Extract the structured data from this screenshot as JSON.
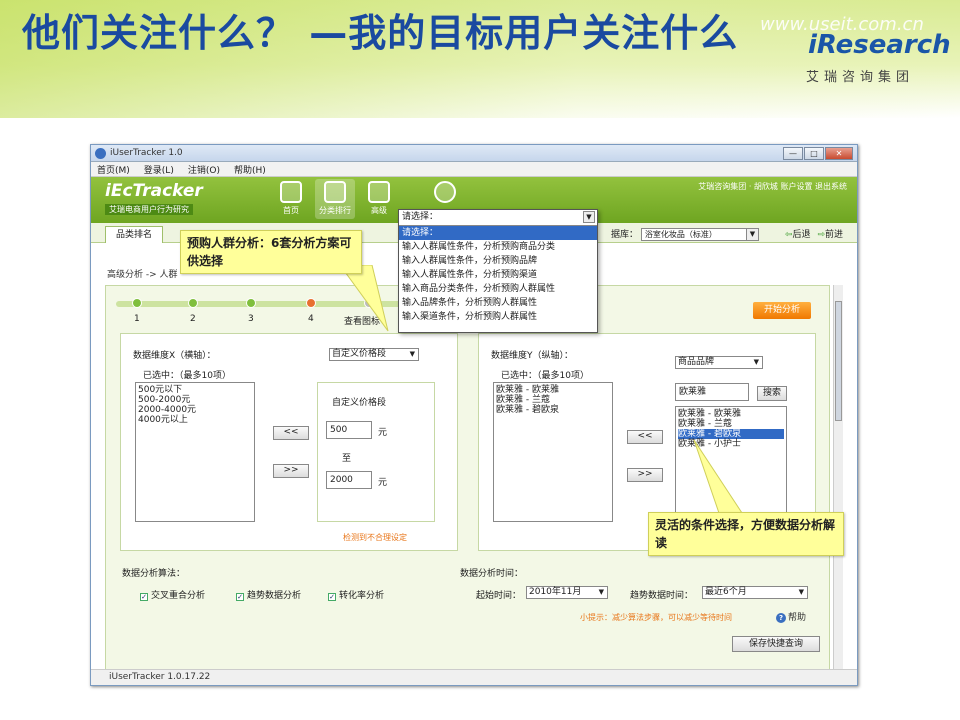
{
  "slide": {
    "title": "他们关注什么？  —我的目标用户关注什么",
    "watermark": "www.useit.com.cn",
    "logo": "iResearch",
    "logo_cn": "艾瑞咨询集团"
  },
  "window": {
    "title": "iUserTracker 1.0",
    "controls": [
      "—",
      "□",
      "✕"
    ],
    "menu": [
      "首页(M)",
      "登录(L)",
      "注销(O)",
      "帮助(H)"
    ],
    "brand": "iEcTracker",
    "brand_sub": "艾瑞电商用户行为研究",
    "nav": [
      "首页",
      "分类排行",
      "高级"
    ],
    "top_right": "艾瑞咨询集团 · 胡欣城  账户设置  退出系统",
    "tab": "品类排名",
    "db_label": "据库：",
    "db_value": "浴室化妆品（标准）",
    "back": "后退",
    "forward": "前进",
    "breadcrumb": "高级分析 -> 人群",
    "status": "iUserTracker 1.0.17.22"
  },
  "steps": {
    "labels": [
      "1",
      "2",
      "3",
      "4",
      "查看图标"
    ],
    "current_index": 3,
    "start_button": "开始分析"
  },
  "dimension_x": {
    "title": "数据维度X（横轴）：",
    "selector": "自定义价格段",
    "selected_label": "已选中：（最多10项）",
    "items": [
      "500元以下",
      "500-2000元",
      "2000-4000元",
      "4000元以上"
    ],
    "range_title": "自定义价格段",
    "from": "500",
    "to": "2000",
    "to_label": "至",
    "unit": "元",
    "move_left": "<<",
    "move_right": ">>",
    "warning": "检测到不合理设定"
  },
  "dimension_y": {
    "title": "数据维度Y（纵轴）：",
    "selector": "商品品牌",
    "selected_label": "已选中：（最多10项）",
    "items": [
      "欧莱雅 - 欧莱雅",
      "欧莱雅 - 兰蔻",
      "欧莱雅 - 碧欧泉"
    ],
    "search_value": "欧莱雅",
    "search_button": "搜索",
    "results": [
      "欧莱雅 - 欧莱雅",
      "欧莱雅 - 兰蔻",
      "欧莱雅 - 碧欧泉",
      "欧莱雅 - 小护士"
    ],
    "highlighted_result": 2,
    "move_left": "<<",
    "move_right": ">>"
  },
  "algorithm": {
    "title": "数据分析算法：",
    "options": [
      "交叉重合分析",
      "趋势数据分析",
      "转化率分析"
    ]
  },
  "time": {
    "title": "数据分析时间：",
    "start_label": "起始时间：",
    "start_value": "2010年11月",
    "trend_label": "趋势数据时间：",
    "trend_value": "最近6个月",
    "tip": "小提示：减少算法步骤，可以减少等待时间",
    "help": "帮助",
    "save": "保存快捷查询"
  },
  "dropdown": {
    "head": "请选择：",
    "options": [
      "请选择：",
      "输入人群属性条件，分析预购商品分类",
      "输入人群属性条件，分析预购品牌",
      "输入人群属性条件，分析预购渠道",
      "输入商品分类条件，分析预购人群属性",
      "输入品牌条件，分析预购人群属性",
      "输入渠道条件，分析预购人群属性"
    ],
    "highlighted": 0
  },
  "callouts": {
    "left": "预购人群分析：6套分析方案可供选择",
    "right": "灵活的条件选择，方便数据分析解读"
  },
  "colors": {
    "title": "#1a4aa0",
    "green": "#7ab02e",
    "orange": "#f07800",
    "callout": "#ffff9a"
  }
}
